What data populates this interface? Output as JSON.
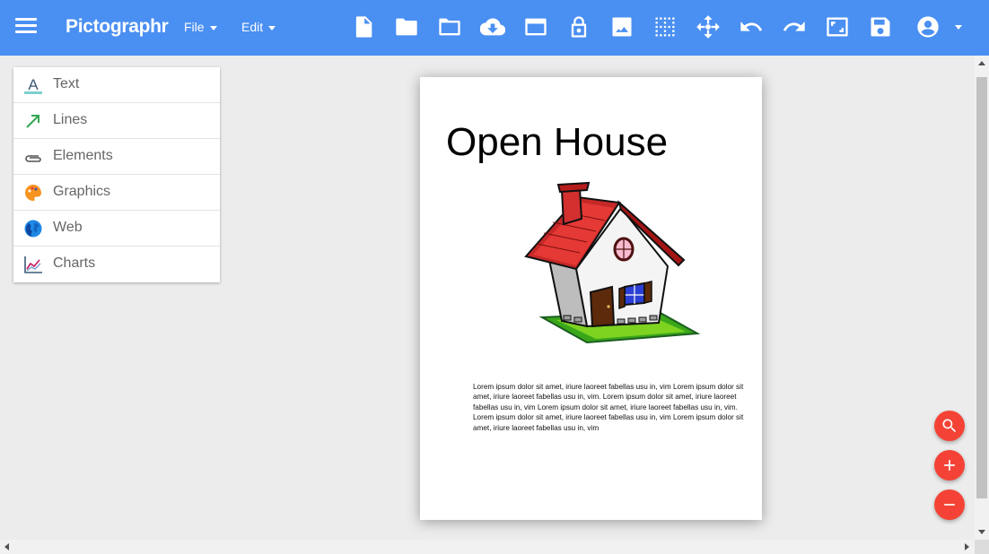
{
  "app": {
    "name": "Pictographr"
  },
  "menus": [
    {
      "label": "File"
    },
    {
      "label": "Edit"
    }
  ],
  "toolbar_icons": [
    "new-document-icon",
    "open-folder-icon",
    "folder-icon",
    "cloud-download-icon",
    "window-icon",
    "lock-open-icon",
    "image-icon",
    "grid-icon",
    "move-icon",
    "undo-icon",
    "redo-icon",
    "fit-screen-icon",
    "save-icon",
    "account-icon"
  ],
  "sidebar": {
    "items": [
      {
        "label": "Text",
        "icon": "text-icon"
      },
      {
        "label": "Lines",
        "icon": "arrow-line-icon"
      },
      {
        "label": "Elements",
        "icon": "paperclip-icon"
      },
      {
        "label": "Graphics",
        "icon": "palette-icon"
      },
      {
        "label": "Web",
        "icon": "globe-icon"
      },
      {
        "label": "Charts",
        "icon": "line-chart-icon"
      }
    ]
  },
  "document": {
    "title": "Open House",
    "body": "Lorem ipsum dolor sit amet, iriure laoreet fabellas usu in, vim Lorem ipsum dolor sit amet, iriure laoreet fabellas usu in, vim. Lorem ipsum dolor sit amet, iriure laoreet fabellas usu in, vim Lorem ipsum dolor sit amet, iriure laoreet fabellas usu in, vim. Lorem ipsum dolor sit amet, iriure laoreet fabellas usu in, vim Lorem ipsum dolor sit amet, iriure laoreet fabellas usu in, vim"
  },
  "fabs": [
    "search-icon",
    "plus-icon",
    "minus-icon"
  ],
  "colors": {
    "topbar": "#4a8ff2",
    "fab": "#f44336",
    "background": "#ececec"
  }
}
